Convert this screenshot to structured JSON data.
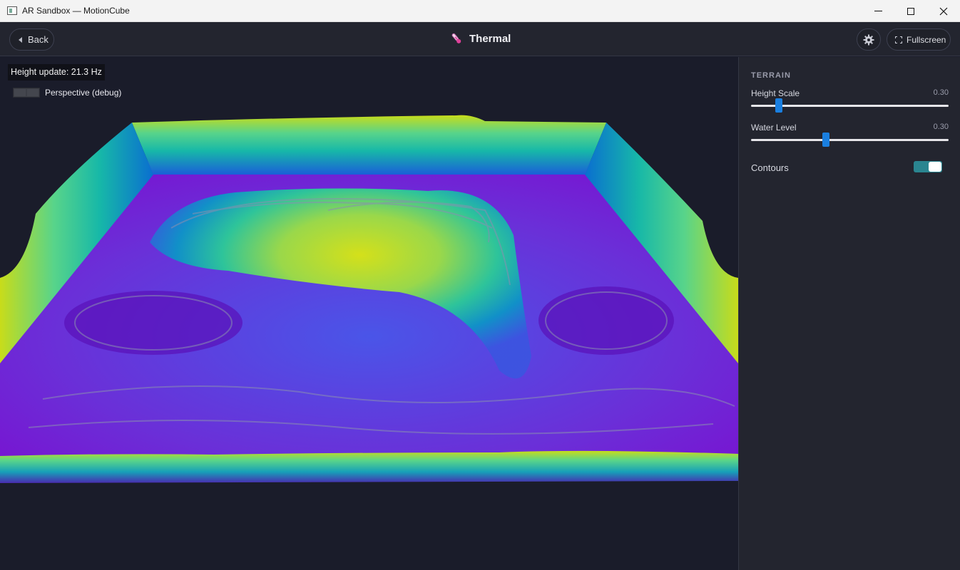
{
  "window": {
    "title": "AR Sandbox — MotionCube",
    "app_icon": "window-app-icon"
  },
  "header": {
    "back_label": "Back",
    "title": "Thermal",
    "title_icon": "thermometer-icon",
    "settings_icon": "gear-icon",
    "fullscreen_label": "Fullscreen",
    "fullscreen_icon": "fullscreen-icon"
  },
  "viewport": {
    "height_update": "Height update: 21.3 Hz",
    "debug_label": "Perspective (debug)",
    "debug_enabled": false,
    "colormap": [
      "#6a0fd0",
      "#3a4fe0",
      "#0a7fd0",
      "#17b8a8",
      "#58d48a",
      "#c8dc1a"
    ]
  },
  "panel": {
    "section": "TERRAIN",
    "height_scale": {
      "label": "Height Scale",
      "value_text": "0.30",
      "fraction": 0.14
    },
    "water_level": {
      "label": "Water Level",
      "value_text": "0.30",
      "fraction": 0.38
    },
    "contours": {
      "label": "Contours",
      "enabled": true
    }
  },
  "colors": {
    "accent": "#1a7fe0",
    "toggle_on": "#2a8590",
    "panel_bg": "#23252f",
    "viewport_bg": "#1a1c2a"
  }
}
